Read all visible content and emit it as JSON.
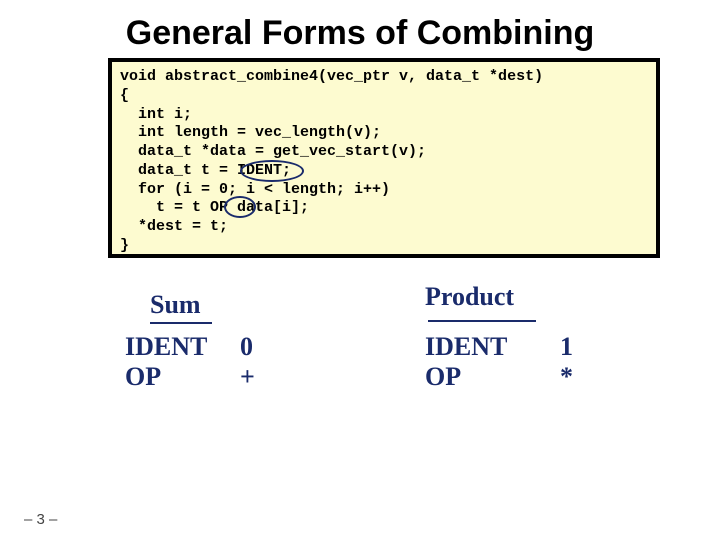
{
  "title": "General Forms of Combining",
  "code": "void abstract_combine4(vec_ptr v, data_t *dest)\n{\n  int i;\n  int length = vec_length(v);\n  data_t *data = get_vec_start(v);\n  data_t t = IDENT;\n  for (i = 0; i < length; i++)\n    t = t OP data[i];\n  *dest = t;\n}",
  "annotations": {
    "sum": {
      "title": "Sum",
      "labels": "IDENT\nOP",
      "values": "0\n+"
    },
    "product": {
      "title": "Product",
      "labels": "IDENT\nOP",
      "values": "1\n*"
    }
  },
  "page_number": "– 3 –"
}
